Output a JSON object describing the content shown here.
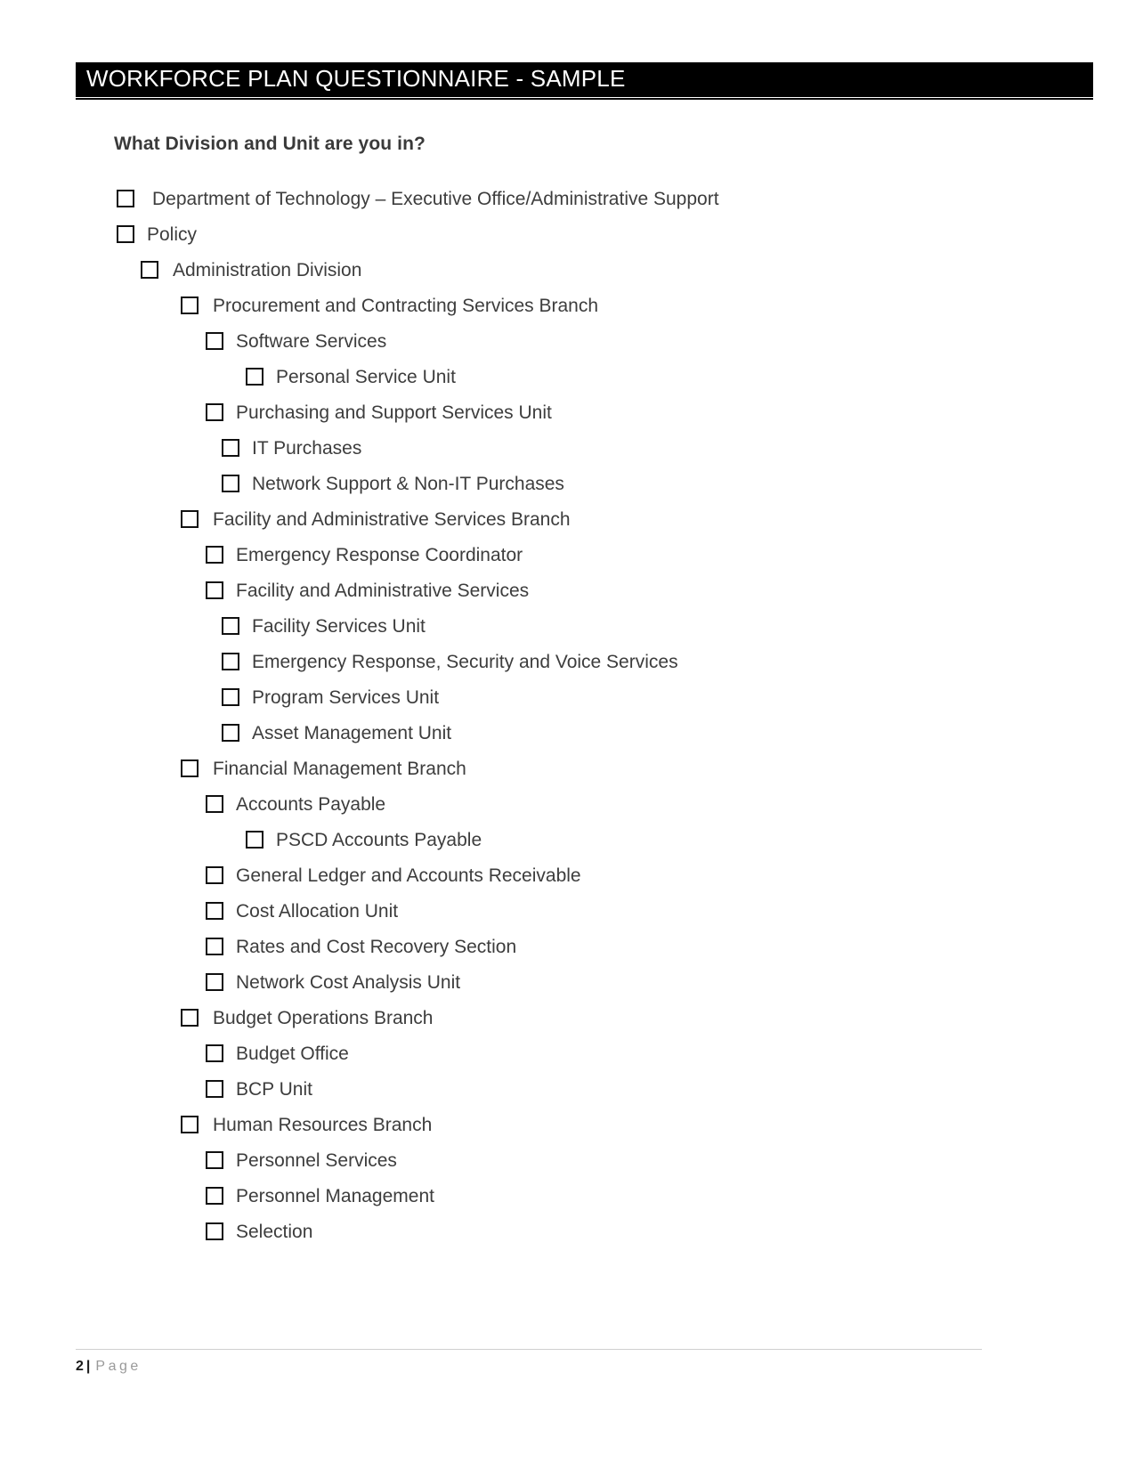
{
  "document": {
    "header_title": "WORKFORCE PLAN QUESTIONNAIRE - SAMPLE",
    "question_heading": "What Division and Unit are you in?"
  },
  "colors": {
    "banner_background": "#000000",
    "banner_text": "#ffffff",
    "heading_text": "#3a3a3a",
    "body_text": "#3d3d3d",
    "checkbox_border": "#111111",
    "footer_rule": "#d0d0d0",
    "footer_word": "#9a9a9a"
  },
  "checklist": {
    "items": [
      {
        "label": "Department of Technology – Executive Office/Administrative Support",
        "level": 0,
        "checked": false
      },
      {
        "label": "Policy",
        "level": 1,
        "checked": false
      },
      {
        "label": "Administration Division",
        "level": 2,
        "checked": false
      },
      {
        "label": "Procurement and Contracting Services Branch",
        "level": 3,
        "checked": false
      },
      {
        "label": "Software Services",
        "level": 4,
        "checked": false
      },
      {
        "label": "Personal Service Unit",
        "level": 5,
        "checked": false
      },
      {
        "label": "Purchasing and Support Services Unit",
        "level": 4,
        "checked": false
      },
      {
        "label": "IT Purchases",
        "level": 6,
        "checked": false
      },
      {
        "label": "Network Support & Non-IT Purchases",
        "level": 6,
        "checked": false
      },
      {
        "label": "Facility and Administrative Services Branch",
        "level": 3,
        "checked": false
      },
      {
        "label": "Emergency Response Coordinator",
        "level": 4,
        "checked": false
      },
      {
        "label": "Facility and Administrative Services",
        "level": 4,
        "checked": false
      },
      {
        "label": "Facility Services Unit",
        "level": 6,
        "checked": false
      },
      {
        "label": "Emergency Response, Security and Voice Services",
        "level": 6,
        "checked": false
      },
      {
        "label": "Program Services Unit",
        "level": 6,
        "checked": false
      },
      {
        "label": "Asset Management Unit",
        "level": 6,
        "checked": false
      },
      {
        "label": "Financial Management Branch",
        "level": 3,
        "checked": false
      },
      {
        "label": "Accounts Payable",
        "level": 4,
        "checked": false
      },
      {
        "label": "PSCD Accounts Payable",
        "level": 5,
        "checked": false
      },
      {
        "label": "General Ledger and Accounts Receivable",
        "level": 4,
        "checked": false
      },
      {
        "label": "Cost Allocation Unit",
        "level": 4,
        "checked": false
      },
      {
        "label": "Rates and Cost Recovery Section",
        "level": 4,
        "checked": false
      },
      {
        "label": "Network Cost Analysis Unit",
        "level": 4,
        "checked": false
      },
      {
        "label": "Budget Operations Branch",
        "level": 3,
        "checked": false
      },
      {
        "label": "Budget Office",
        "level": 4,
        "checked": false
      },
      {
        "label": "BCP Unit",
        "level": 4,
        "checked": false
      },
      {
        "label": "Human Resources Branch",
        "level": 3,
        "checked": false
      },
      {
        "label": "Personnel Services",
        "level": 4,
        "checked": false
      },
      {
        "label": "Personnel Management",
        "level": 4,
        "checked": false
      },
      {
        "label": "Selection",
        "level": 4,
        "checked": false
      }
    ]
  },
  "footer": {
    "page_number": "2",
    "separator": "|",
    "page_word": "Page"
  }
}
